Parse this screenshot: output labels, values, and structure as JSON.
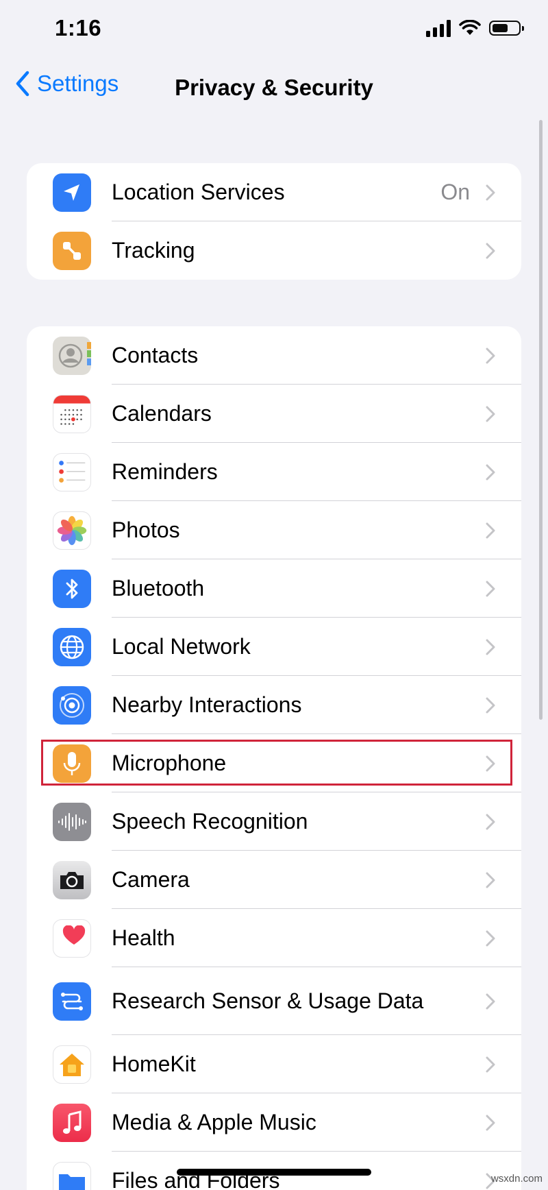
{
  "status_bar": {
    "time": "1:16"
  },
  "nav": {
    "back_label": "Settings",
    "title": "Privacy & Security"
  },
  "group1": [
    {
      "label": "Location Services",
      "value": "On",
      "icon": "location-arrow-icon",
      "color": "#2f7cf6"
    },
    {
      "label": "Tracking",
      "icon": "tracking-icon",
      "color": "#f3a33a"
    }
  ],
  "group2": [
    {
      "label": "Contacts",
      "icon": "contacts-icon"
    },
    {
      "label": "Calendars",
      "icon": "calendar-icon"
    },
    {
      "label": "Reminders",
      "icon": "reminders-icon"
    },
    {
      "label": "Photos",
      "icon": "photos-icon"
    },
    {
      "label": "Bluetooth",
      "icon": "bluetooth-icon",
      "color": "#2f7cf6"
    },
    {
      "label": "Local Network",
      "icon": "globe-icon",
      "color": "#2f7cf6"
    },
    {
      "label": "Nearby Interactions",
      "icon": "nearby-interactions-icon",
      "color": "#2f7cf6"
    },
    {
      "label": "Microphone",
      "icon": "microphone-icon",
      "color": "#f3a33a",
      "highlighted": true
    },
    {
      "label": "Speech Recognition",
      "icon": "waveform-icon",
      "color": "#8e8e93"
    },
    {
      "label": "Camera",
      "icon": "camera-icon"
    },
    {
      "label": "Health",
      "icon": "heart-icon"
    },
    {
      "label": "Research Sensor & Usage Data",
      "icon": "research-icon",
      "color": "#2f7cf6"
    },
    {
      "label": "HomeKit",
      "icon": "home-icon"
    },
    {
      "label": "Media & Apple Music",
      "icon": "music-note-icon",
      "color": "#f2445a"
    },
    {
      "label": "Files and Folders",
      "icon": "folder-icon",
      "color": "#2f7cf6"
    }
  ],
  "watermark": "wsxdn.com"
}
